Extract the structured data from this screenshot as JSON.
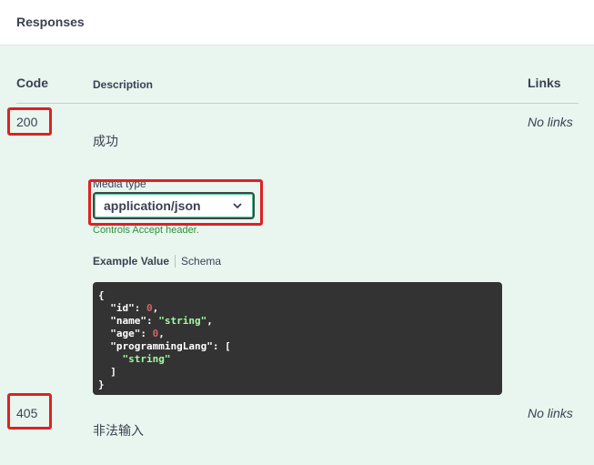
{
  "header": {
    "title": "Responses"
  },
  "table": {
    "headers": {
      "code": "Code",
      "description": "Description",
      "links": "Links"
    },
    "rows": [
      {
        "code": "200",
        "description": "成功",
        "links": "No links"
      },
      {
        "code": "405",
        "description": "非法输入",
        "links": "No links"
      }
    ]
  },
  "media": {
    "label": "Media type",
    "selected": "application/json",
    "note": "Controls Accept header."
  },
  "example_tabs": {
    "example": "Example Value",
    "schema": "Schema"
  },
  "example_code": {
    "open_brace": "{",
    "close_brace": "}",
    "id_key": "\"id\"",
    "id_value": "0",
    "name_key": "\"name\"",
    "name_value": "\"string\"",
    "age_key": "\"age\"",
    "age_value": "0",
    "lang_key": "\"programmingLang\"",
    "lang_open": "[",
    "lang_item": "\"string\"",
    "lang_close": "]"
  },
  "colors": {
    "background": "#e9f6f0",
    "highlight": "#e02020",
    "code_bg": "#333333",
    "string": "#a2fca2",
    "number": "#d36363",
    "note_green": "#2f8f35"
  },
  "icons": {
    "select": "chevron-down-icon"
  }
}
